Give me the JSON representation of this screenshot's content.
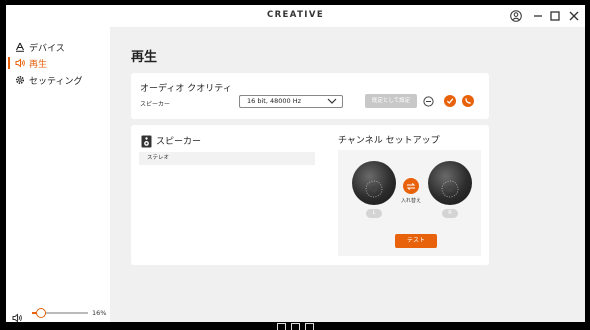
{
  "window": {
    "brand": "CREATIVE"
  },
  "sidebar": {
    "items": [
      {
        "label": "デバイス",
        "icon": "device-icon",
        "active": false
      },
      {
        "label": "再生",
        "icon": "speaker-wave-icon",
        "active": true
      },
      {
        "label": "セッティング",
        "icon": "gear-icon",
        "active": false
      }
    ],
    "volume": {
      "percent_label": "16%",
      "level": 0.16
    }
  },
  "main": {
    "title": "再生",
    "audio_quality": {
      "title": "オーディオ クオリティ",
      "row_label": "スピーカー",
      "selected_format": "16 bit, 48000 Hz",
      "set_default_label": "既定として設定"
    },
    "speaker_card": {
      "title": "スピーカー",
      "list_item": "ステレオ",
      "setup_title": "チャンネル セットアップ",
      "left_label": "L",
      "right_label": "R",
      "swap_label": "入れ替え",
      "test_label": "テスト"
    }
  },
  "colors": {
    "accent": "#e8620c",
    "card": "#ffffff",
    "background": "#f0f0f0"
  }
}
